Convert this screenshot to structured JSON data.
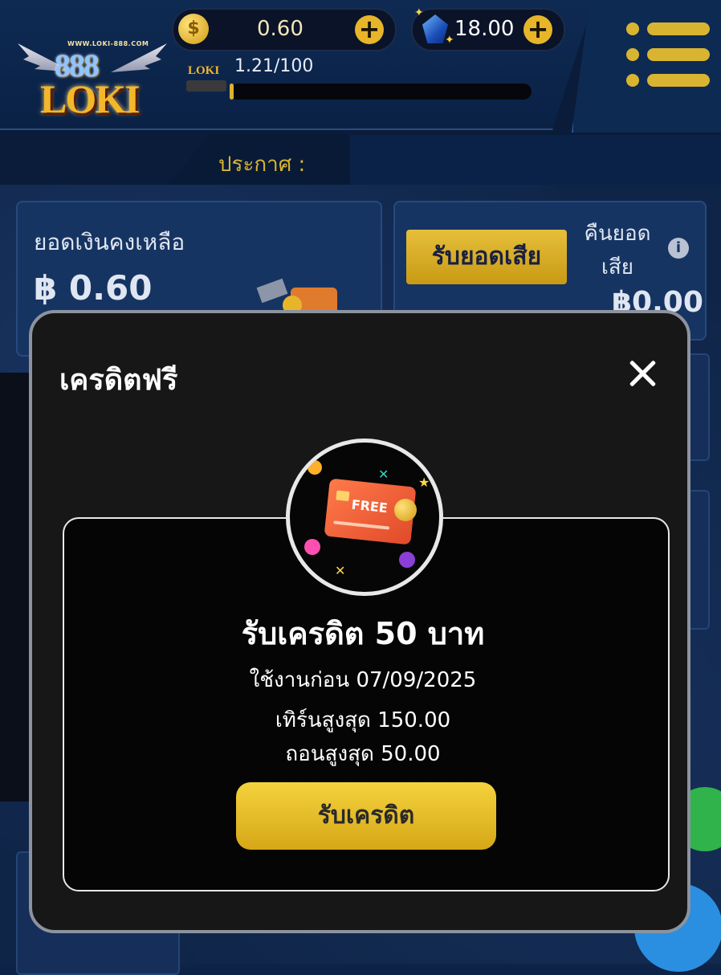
{
  "header": {
    "logo_site": "WWW.LOKI-888.COM",
    "logo_number": "888",
    "logo_name": "LOKI",
    "coin_symbol": "$",
    "coin_balance": "0.60",
    "gem_balance": "18.00",
    "level_badge": "LOKI",
    "level_progress_text": "1.21/100",
    "level_progress_fraction": 0.0121,
    "announcement_label": "ประกาศ :"
  },
  "balance_card": {
    "title": "ยอดเงินคงเหลือ",
    "amount": "฿ 0.60"
  },
  "cashback_card": {
    "button_label": "รับยอดเสีย",
    "label": "คืนยอดเสีย",
    "info_symbol": "i",
    "amount": "฿0.00"
  },
  "modal": {
    "title": "เครดิตฟรี",
    "close_symbol": "×",
    "badge_text": "FREE",
    "offer_title": "รับเครดิต 50 บาท",
    "expiry": "ใช้งานก่อน 07/09/2025",
    "max_turnover": "เทิร์นสูงสุด 150.00",
    "max_withdraw": "ถอนสูงสุด 50.00",
    "claim_button": "รับเครดิต"
  },
  "colors": {
    "accent_gold": "#d9b431",
    "background_navy": "#0d2347",
    "modal_bg": "#171717"
  },
  "icons": [
    "coin-icon",
    "gem-icon",
    "plus-icon",
    "menu-icon",
    "info-icon",
    "close-icon",
    "free-credit-card-icon"
  ]
}
